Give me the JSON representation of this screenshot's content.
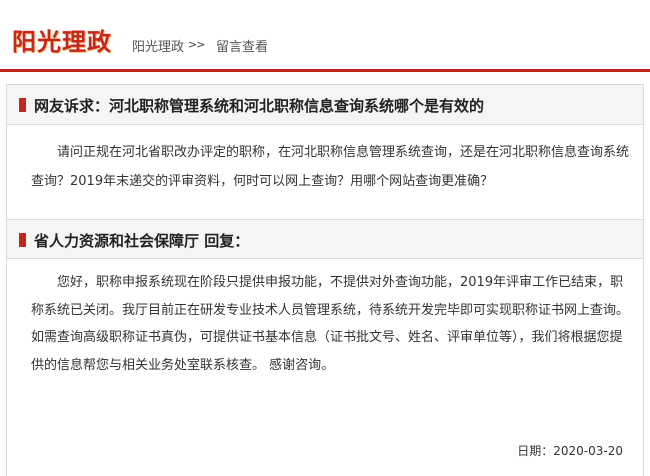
{
  "header": {
    "logo": "阳光理政",
    "breadcrumb_home": "阳光理政",
    "breadcrumb_sep": ">>",
    "breadcrumb_current": "留言查看"
  },
  "question": {
    "title": "网友诉求：河北职称管理系统和河北职称信息查询系统哪个是有效的",
    "body": "请问正规在河北省职改办评定的职称，在河北职称信息管理系统查询，还是在河北职称信息查询系统查询？2019年末递交的评审资料，何时可以网上查询？用哪个网站查询更准确？"
  },
  "reply": {
    "title": "省人力资源和社会保障厅 回复：",
    "body": "您好，职称申报系统现在阶段只提供申报功能，不提供对外查询功能，2019年评审工作已结束，职称系统已关闭。我厅目前正在研发专业技术人员管理系统，待系统开发完毕即可实现职称证书网上查询。如需查询高级职称证书真伪，可提供证书基本信息（证书批文号、姓名、评审单位等），我们将根据您提供的信息帮您与相关业务处室联系核查。 感谢咨询。",
    "date": "日期：2020-03-20"
  },
  "colors": {
    "accent": "#c0271e",
    "section_bg": "#f5f5f5"
  }
}
